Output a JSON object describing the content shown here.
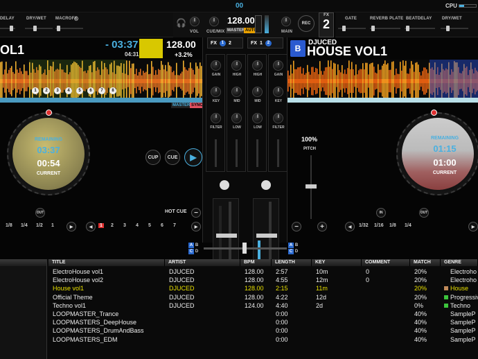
{
  "topbar": {
    "deck_indicator": "00",
    "cpu_label": "CPU"
  },
  "fx_left": {
    "delay_label": "DELAY",
    "drywet_label": "DRY/WET",
    "macrofx_label": "MACROFX"
  },
  "master": {
    "vol_label": "VOL",
    "bpm": "128.00",
    "cue_mix_label": "CUE/MIX",
    "master_label": "MASTER",
    "auto_label": "AUTO",
    "main_label": "MAIN",
    "rec_label": "REC",
    "fx_badge": "FX",
    "fx_num": "2"
  },
  "fx_right": {
    "gate_label": "GATE",
    "reverb_label": "REVERB PLATE",
    "beatdelay_label": "BEATDELAY",
    "drywet_label": "DRY/WET"
  },
  "deck_a": {
    "title_partial": "OL1",
    "time": "- 03:37",
    "time_small": "04:31",
    "bpm": "128.00",
    "pitch_offset": "+3.2%",
    "master_btn": "MASTER",
    "sync_btn": "SYNC",
    "remaining_label": "REMAINING",
    "remaining": "03:37",
    "current": "00:54",
    "current_label": "CURRENT",
    "cup": "CUP",
    "cue": "CUE",
    "out": "OUT",
    "hotcue_label": "HOT CUE",
    "loop_sizes": [
      "1/8",
      "1/4",
      "1/2",
      "1"
    ],
    "hotcues": [
      "1",
      "2",
      "3",
      "4",
      "5",
      "6",
      "7"
    ],
    "beat_markers": [
      "1",
      "2",
      "3",
      "4",
      "5",
      "6",
      "7",
      "8"
    ]
  },
  "deck_b": {
    "letter": "B",
    "artist": "DJUCED",
    "title": "HOUSE VOL1",
    "remaining_label": "REMAINING",
    "remaining": "01:15",
    "current": "01:00",
    "current_label": "CURRENT",
    "pitch_pct": "100%",
    "pitch_label": "PITCH",
    "in": "IN",
    "out": "OUT",
    "loop_sizes": [
      "1/32",
      "1/16",
      "1/8",
      "1/4"
    ]
  },
  "mixer": {
    "fx1": {
      "label": "FX",
      "a": "1",
      "b": "2"
    },
    "fx2": {
      "label": "FX",
      "a": "1",
      "b": "2"
    },
    "eq_labels": [
      "GAIN",
      "HIGH",
      "HIGH",
      "GAIN",
      "KEY",
      "MID",
      "MID",
      "KEY",
      "FILTER",
      "LOW",
      "LOW",
      "FILTER"
    ],
    "ab_left": [
      "A",
      "B",
      "C",
      "D"
    ],
    "ab_right": [
      "A",
      "B",
      "C",
      "D"
    ]
  },
  "library": {
    "columns": [
      "TITLE",
      "ARTIST",
      "BPM",
      "LENGTH",
      "KEY",
      "COMMENT",
      "MATCH",
      "GENRE"
    ],
    "rows": [
      [
        "ElectroHouse vol1",
        "DJUCED",
        "128.00",
        "2:57",
        "10m",
        "0",
        "20%",
        "Electroho"
      ],
      [
        "ElectroHouse vol2",
        "DJUCED",
        "128.00",
        "4:55",
        "12m",
        "0",
        "20%",
        "Electroho"
      ],
      [
        "House vol1",
        "DJUCED",
        "128.00",
        "2:15",
        "11m",
        "",
        "20%",
        "House"
      ],
      [
        "Official Theme",
        "DJUCED",
        "128.00",
        "4:22",
        "12d",
        "",
        "20%",
        "Progressiv"
      ],
      [
        "Techno vol1",
        "DJUCED",
        "124.00",
        "4:40",
        "2d",
        "",
        "0%",
        "Techno"
      ],
      [
        "LOOPMASTER_Trance",
        "",
        "",
        "0:00",
        "",
        "",
        "40%",
        "SampleP"
      ],
      [
        "LOOPMASTERS_DeepHouse",
        "",
        "",
        "0:00",
        "",
        "",
        "40%",
        "SampleP"
      ],
      [
        "LOOPMASTERS_DrumAndBass",
        "",
        "",
        "0:00",
        "",
        "",
        "40%",
        "SampleP"
      ],
      [
        "LOOPMASTERS_EDM",
        "",
        "",
        "0:00",
        "",
        "",
        "40%",
        "SampleP"
      ]
    ],
    "genre_colors": [
      "",
      "",
      "#c08a5a",
      "#3cc43c",
      "#3cc43c",
      "",
      "",
      "",
      ""
    ]
  },
  "colors": {
    "accent": "#4ab0e0",
    "highlight": "#e8e000",
    "waveform_a": "#e07020",
    "waveform_b": "#e06010"
  }
}
